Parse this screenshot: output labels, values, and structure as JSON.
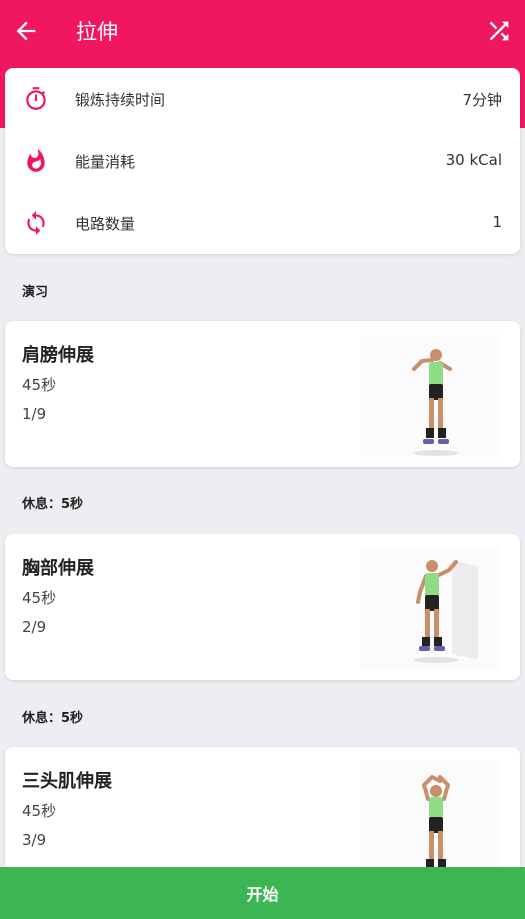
{
  "header": {
    "title": "拉伸",
    "back_icon": "arrow-left-icon",
    "shuffle_icon": "shuffle-icon"
  },
  "stats": [
    {
      "icon": "stopwatch-icon",
      "label": "锻炼持续时间",
      "value": "7分钟"
    },
    {
      "icon": "flame-icon",
      "label": "能量消耗",
      "value": "30 kCal"
    },
    {
      "icon": "repeat-icon",
      "label": "电路数量",
      "value": "1"
    }
  ],
  "section_title": "演习",
  "exercises": [
    {
      "name": "肩膀伸展",
      "duration": "45秒",
      "index": "1/9"
    },
    {
      "name": "胸部伸展",
      "duration": "45秒",
      "index": "2/9"
    },
    {
      "name": "三头肌伸展",
      "duration": "45秒",
      "index": "3/9"
    }
  ],
  "rests": [
    {
      "label": "休息：",
      "value": "5秒"
    },
    {
      "label": "休息：",
      "value": "5秒"
    }
  ],
  "start_label": "开始",
  "colors": {
    "brand": "#f0175e",
    "start": "#3cb653",
    "background": "#eceef2"
  }
}
